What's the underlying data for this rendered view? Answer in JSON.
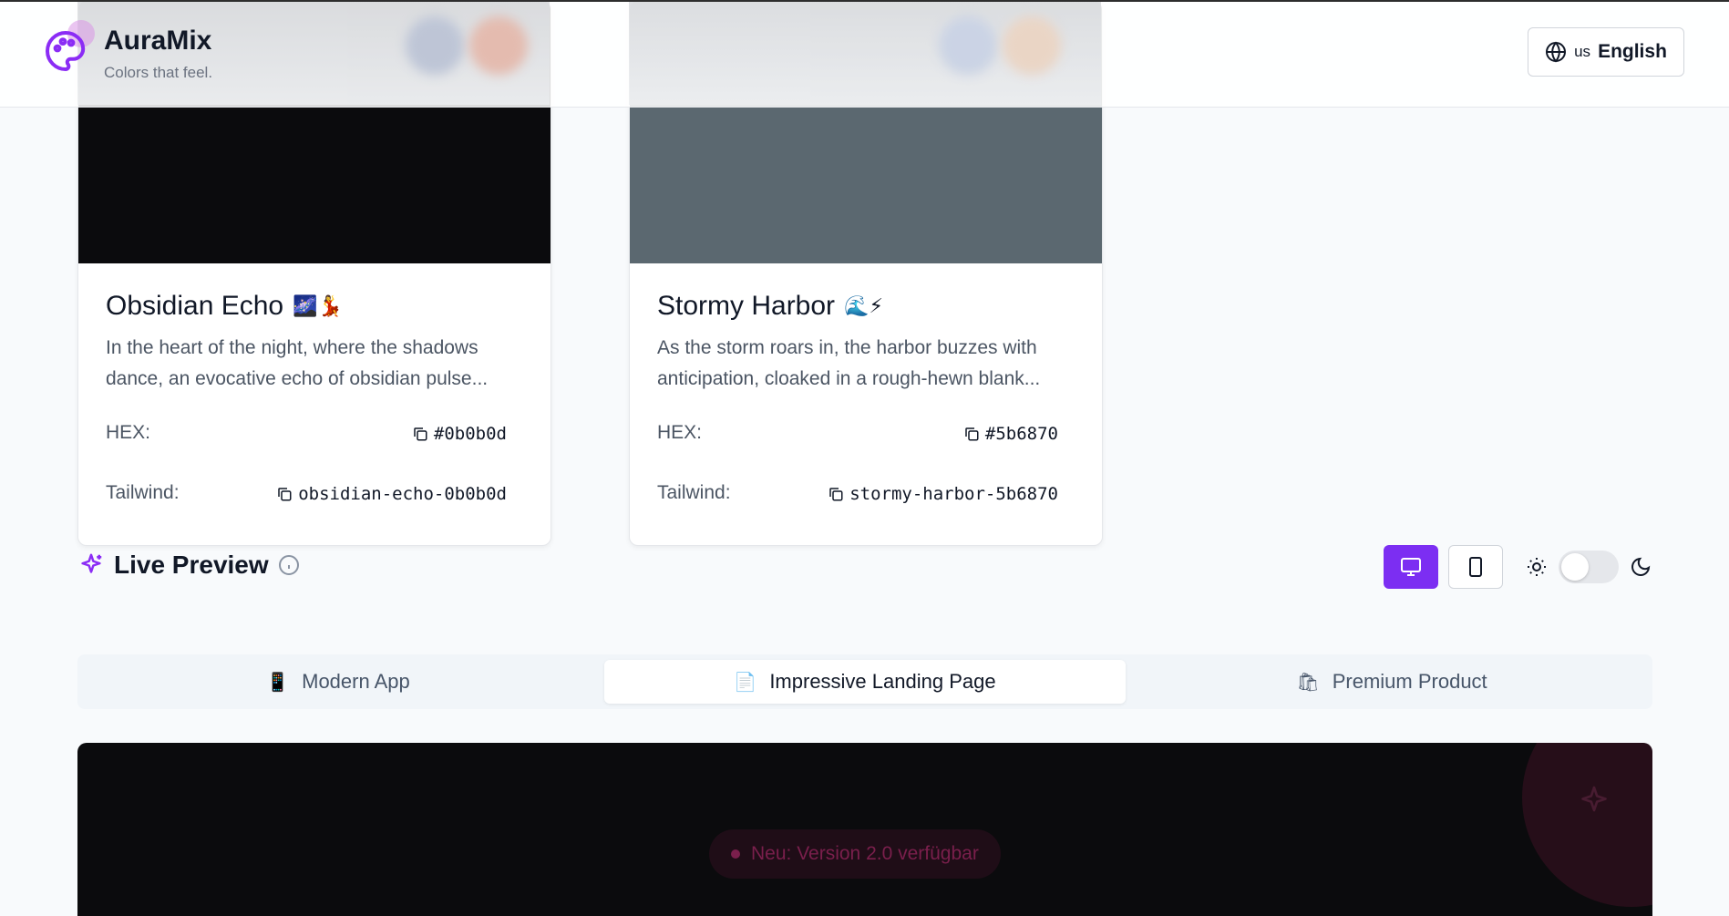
{
  "header": {
    "brand_name": "AuraMix",
    "tagline": "Colors that feel.",
    "language": {
      "code": "us",
      "label": "English"
    }
  },
  "cards": [
    {
      "name": "Obsidian Echo",
      "emoji": "🌌💃",
      "color": "#0b0b0d",
      "description_line1": "In the heart of the night, where the shadows",
      "description_line2": "dance, an evocative echo of obsidian pulse...",
      "hex_label": "HEX:",
      "hex_value": "#0b0b0d",
      "tailwind_label": "Tailwind:",
      "tailwind_value": "obsidian-echo-0b0b0d"
    },
    {
      "name": "Stormy Harbor",
      "emoji": "🌊⚡",
      "color": "#5b6870",
      "description_line1": "As the storm roars in, the harbor buzzes with",
      "description_line2": "anticipation, cloaked in a rough-hewn blank...",
      "hex_label": "HEX:",
      "hex_value": "#5b6870",
      "tailwind_label": "Tailwind:",
      "tailwind_value": "stormy-harbor-5b6870"
    }
  ],
  "live_preview": {
    "title": "Live Preview",
    "icons": [
      "sparkles-icon",
      "info-icon",
      "desktop-icon",
      "tablet-icon",
      "sun-icon",
      "moon-icon"
    ],
    "dark_mode": false
  },
  "tabs": [
    {
      "icon": "📱",
      "label": "Modern App",
      "active": false
    },
    {
      "icon": "📄",
      "label": "Impressive Landing Page",
      "active": true
    },
    {
      "icon": "🛍",
      "label": "Premium Product",
      "active": false
    }
  ],
  "preview": {
    "badge_text": "Neu: Version 2.0 verfügbar"
  },
  "colors": {
    "accent": "#7c2ef2",
    "preview_bg": "#0b0b0d",
    "badge_text": "#7a1f4c"
  }
}
